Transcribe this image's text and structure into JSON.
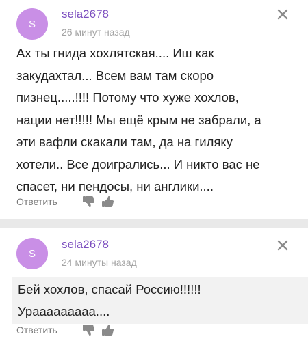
{
  "comments": [
    {
      "avatar_letter": "S",
      "username": "sela2678",
      "timestamp": "26 минут назад",
      "lines": [
        "Ах ты гнида хохлятская.... Иш как",
        "закудахтал... Всем вам там скоро",
        "пизнец.....!!!! Потому что хуже хохлов,",
        "нации нет!!!!! Мы ещё крым не забрали, а",
        "эти вафли скакали там, да на гиляку",
        "хотели.. Все доигрались... И никто вас не",
        "спасет, ни пендосы, ни англики...."
      ],
      "reply_label": "Ответить"
    },
    {
      "avatar_letter": "S",
      "username": "sela2678",
      "timestamp": "24 минуты назад",
      "lines": [
        "Бей хохлов, спасай Россию!!!!!!",
        "Урааааааааа...."
      ],
      "reply_label": "Ответить"
    }
  ],
  "colors": {
    "avatar_bg": "#c98fe6",
    "username": "#7b4dbf",
    "muted": "#a3a3a3",
    "icon": "#8a8a8a"
  },
  "icons": {
    "close": "close-icon",
    "dislike": "thumbs-down-icon",
    "like": "thumbs-up-icon"
  }
}
